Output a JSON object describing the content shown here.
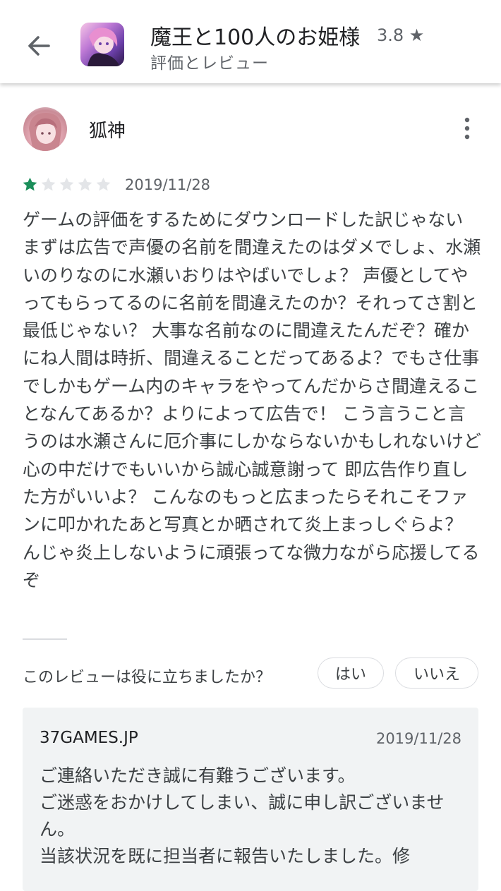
{
  "header": {
    "app_name": "魔王と100人のお姫様",
    "rating": "3.8 ★",
    "subtitle": "評価とレビュー"
  },
  "icons": {
    "back": "arrow-back-icon",
    "more": "more-vert-icon",
    "star": "star-icon"
  },
  "colors": {
    "star_filled": "#1b8e5a",
    "star_empty": "#e3e5e8",
    "reply_background": "#f1f3f4",
    "text_secondary": "#5f6368"
  },
  "review": {
    "author": "狐神",
    "rating": 1,
    "rating_max": 5,
    "date": "2019/11/28",
    "text": "ゲームの評価をするためにダウンロードした訳じゃない まずは広告で声優の名前を間違えたのはダメでしょ、水瀬いのりなのに水瀬いおりはやばいでしょ？ 声優としてやってもらってるのに名前を間違えたのか？それってさ割と最低じゃない？ 大事な名前なのに間違えたんだぞ？確かにね人間は時折、間違えることだってあるよ？でもさ仕事でしかもゲーム内のキャラをやってんだからさ間違えることなんてあるか？よりによって広告で！ こう言うこと言うのは水瀬さんに厄介事にしかならないかもしれないけど心の中だけでもいいから誠心誠意謝って 即広告作り直した方がいいよ？ こんなのもっと広まったらそれこそファンに叩かれたあと写真とか晒されて炎上まっしぐらよ？ んじゃ炎上しないように頑張ってな微力ながら応援してるぞ"
  },
  "helpful": {
    "question": "このレビューは役に立ちましたか？",
    "yes_label": "はい",
    "no_label": "いいえ"
  },
  "developer_reply": {
    "developer": "37GAMES.JP",
    "date": "2019/11/28",
    "text": "ご連絡いただき誠に有難うございます。\nご迷惑をおかけしてしまい、誠に申し訳ございません。\n当該状況を既に担当者に報告いたしました。修"
  }
}
